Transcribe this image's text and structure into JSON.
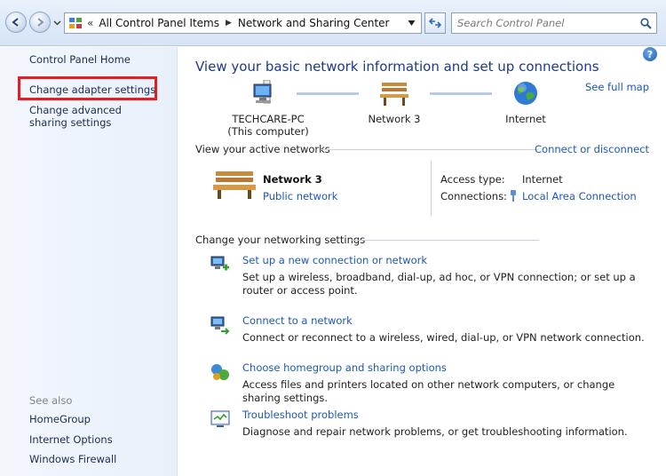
{
  "address": {
    "chevrons": "«",
    "breadcrumbs": [
      "All Control Panel Items",
      "Network and Sharing Center"
    ],
    "search_placeholder": "Search Control Panel"
  },
  "sidebar": {
    "home": "Control Panel Home",
    "items": [
      "Change adapter settings",
      "Change advanced sharing settings"
    ],
    "see_also_label": "See also",
    "see_also": [
      "HomeGroup",
      "Internet Options",
      "Windows Firewall"
    ]
  },
  "main": {
    "title": "View your basic network information and set up connections",
    "see_full_map": "See full map",
    "map": {
      "computer_name": "TECHCARE-PC",
      "computer_sub": "(This computer)",
      "network": "Network 3",
      "internet": "Internet"
    },
    "active_networks_label": "View your active networks",
    "connect_disconnect": "Connect or disconnect",
    "active": {
      "name": "Network  3",
      "type": "Public network",
      "access_type_label": "Access type:",
      "access_type_value": "Internet",
      "connections_label": "Connections:",
      "connections_value": "Local Area Connection"
    },
    "change_settings_label": "Change your networking settings",
    "tasks": [
      {
        "link": "Set up a new connection or network",
        "desc": "Set up a wireless, broadband, dial-up, ad hoc, or VPN connection; or set up a router or access point."
      },
      {
        "link": "Connect to a network",
        "desc": "Connect or reconnect to a wireless, wired, dial-up, or VPN network connection."
      },
      {
        "link": "Choose homegroup and sharing options",
        "desc": "Access files and printers located on other network computers, or change sharing settings."
      },
      {
        "link": "Troubleshoot problems",
        "desc": "Diagnose and repair network problems, or get troubleshooting information."
      }
    ]
  },
  "colors": {
    "link": "#1d58b8",
    "title": "#1e3a8a",
    "highlight": "#e31e24"
  },
  "icons": {
    "help": "?"
  }
}
